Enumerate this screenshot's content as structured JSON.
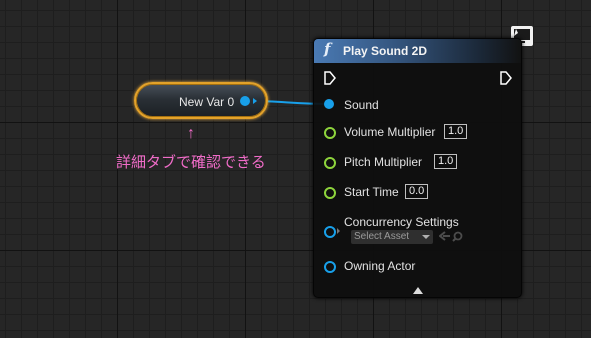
{
  "variable_node": {
    "label": "New Var 0",
    "color": "#e3a22a",
    "pin_color": "#18a0ea"
  },
  "annotation": {
    "arrow": "↑",
    "text": "詳細タブで確認できる",
    "color": "#f06cc8"
  },
  "function_node": {
    "icon": "f",
    "title": "Play Sound 2D",
    "header_color": "#4a7ab4",
    "client_icon": "client-monitor-icon",
    "pins": {
      "sound": {
        "label": "Sound"
      },
      "volume_multiplier": {
        "label": "Volume Multiplier",
        "value": "1.0"
      },
      "pitch_multiplier": {
        "label": "Pitch Multiplier",
        "value": "1.0"
      },
      "start_time": {
        "label": "Start Time",
        "value": "0.0"
      },
      "concurrency_settings": {
        "label": "Concurrency Settings",
        "placeholder": "Select Asset"
      },
      "owning_actor": {
        "label": "Owning Actor"
      }
    },
    "expand_icon": "expand-arrow-icon"
  },
  "colors": {
    "float_pin": "#8ed43c",
    "object_pin": "#18a0ea",
    "exec_pin": "#ffffff"
  }
}
